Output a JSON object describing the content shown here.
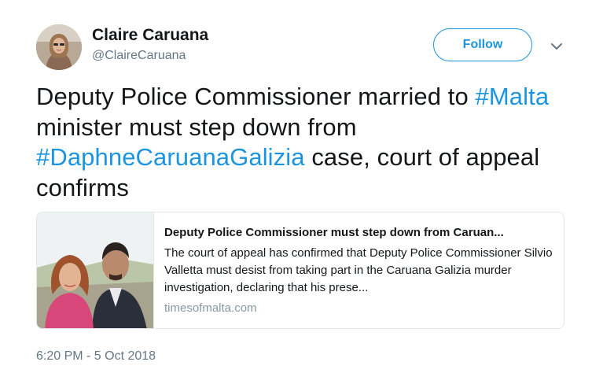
{
  "user": {
    "display_name": "Claire Caruana",
    "handle": "@ClaireCaruana"
  },
  "follow_button": {
    "label": "Follow",
    "color": "#1b95e0"
  },
  "menu": {
    "icon": "chevron-down-icon"
  },
  "tweet": {
    "text_1": "Deputy Police Commissioner married to ",
    "hashtag_1": "#Malta",
    "text_2": " minister must step down from ",
    "hashtag_2": "#DaphneCaruanaGalizia",
    "text_3": " case, court of appeal confirms"
  },
  "card": {
    "title": "Deputy Police Commissioner must step down from Caruan...",
    "description": "The court of appeal has confirmed that Deputy Police Commissioner Silvio Valletta must desist from taking part in the Caruana Galizia murder investigation, declaring that his prese...",
    "domain": "timesofmalta.com"
  },
  "timestamp": "6:20 PM - 5 Oct 2018",
  "colors": {
    "text": "#14171a",
    "secondary": "#657786",
    "link": "#1b95e0",
    "border": "#e1e8ed"
  }
}
